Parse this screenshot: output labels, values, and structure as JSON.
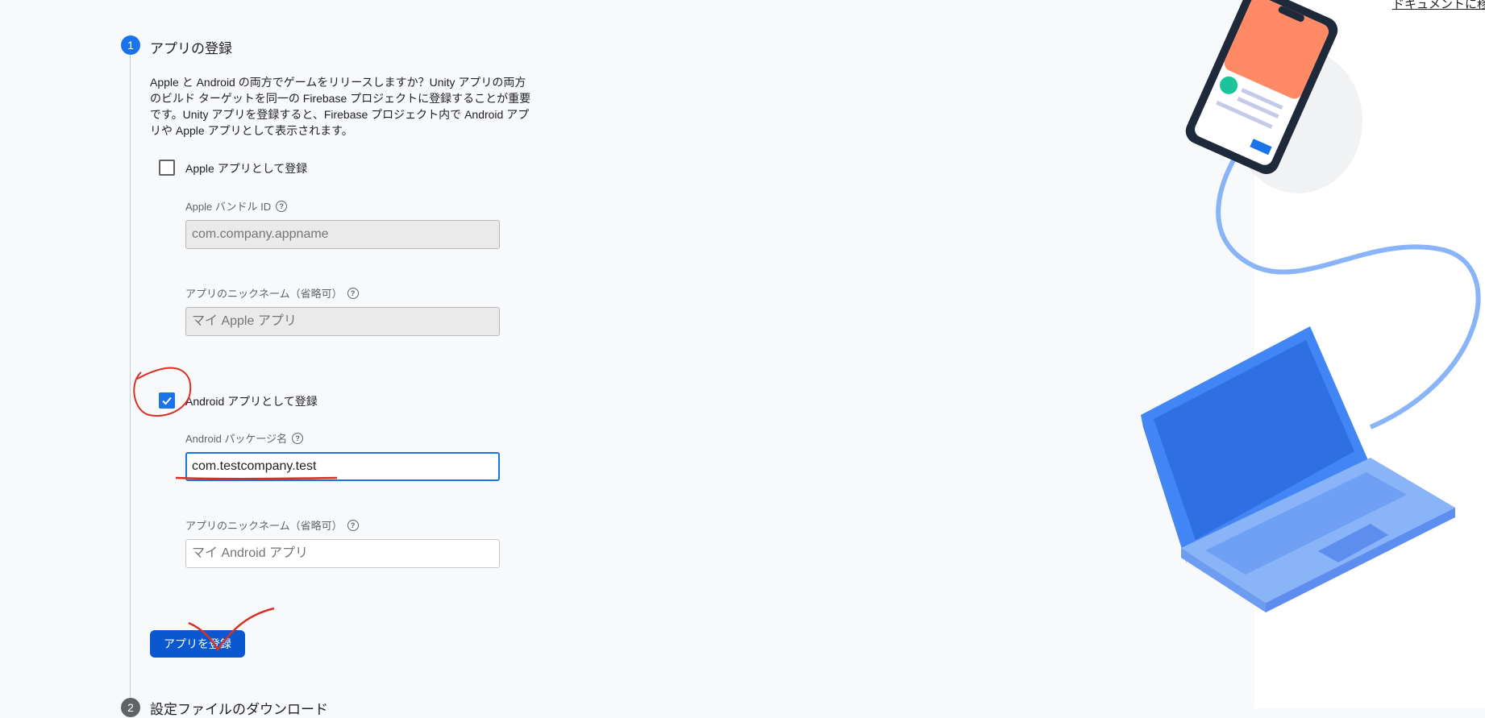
{
  "header": {
    "doc_link_label": "ドキュメントに移"
  },
  "steps": [
    {
      "number": "1",
      "title": "アプリの登録"
    },
    {
      "number": "2",
      "title": "設定ファイルのダウンロード"
    }
  ],
  "intro_text": "Apple と Android の両方でゲームをリリースしますか？Unity アプリの両方のビルド ターゲットを同一の Firebase プロジェクトに登録することが重要です。Unity アプリを登録すると、Firebase プロジェクト内で Android アプリや Apple アプリとして表示されます。",
  "apple": {
    "checkbox_label": "Apple アプリとして登録",
    "checked": false,
    "bundle_id_label": "Apple バンドル ID",
    "bundle_id_placeholder": "com.company.appname",
    "nickname_label": "アプリのニックネーム（省略可）",
    "nickname_placeholder": "マイ Apple アプリ"
  },
  "android": {
    "checkbox_label": "Android アプリとして登録",
    "checked": true,
    "package_label": "Android パッケージ名",
    "package_value": "com.testcompany.test",
    "nickname_label": "アプリのニックネーム（省略可）",
    "nickname_placeholder": "マイ Android アプリ"
  },
  "actions": {
    "register_label": "アプリを登録"
  },
  "icons": {
    "help": "help-circle-icon",
    "check": "check-icon"
  },
  "colors": {
    "accent": "#1a73e8",
    "button": "#0b57d0",
    "annotation": "#d93025"
  }
}
